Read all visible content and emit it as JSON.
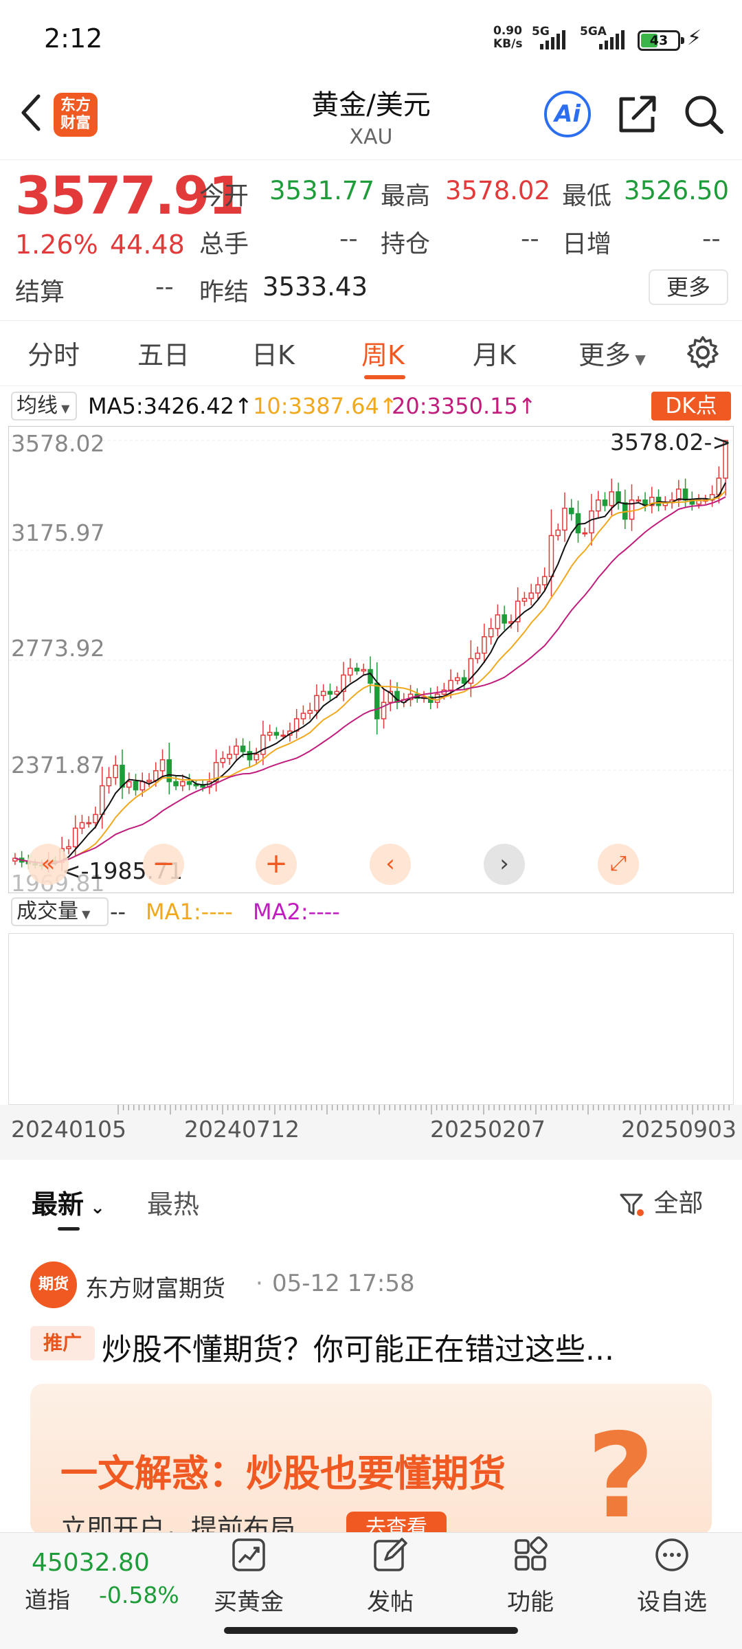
{
  "status": {
    "time": "2:12",
    "net_speed_value": "0.90",
    "net_speed_unit": "KB/s",
    "sig1": "5G",
    "sig2": "5GA",
    "battery": "43"
  },
  "header": {
    "back": "back",
    "logo_text": "东方\n财富",
    "title": "黄金/美元",
    "subtitle": "XAU",
    "ai_label": "Ai"
  },
  "quote": {
    "price": "3577.91",
    "change_pct": "1.26%",
    "change_abs": "44.48",
    "open_label": "今开",
    "open": "3531.77",
    "high_label": "最高",
    "high": "3578.02",
    "low_label": "最低",
    "low": "3526.50",
    "volume_label": "总手",
    "volume": "--",
    "position_label": "持仓",
    "position": "--",
    "daily_inc_label": "日增",
    "daily_inc": "--",
    "settle_label": "结算",
    "settle": "--",
    "prev_settle_label": "昨结",
    "prev_settle": "3533.43",
    "more_button": "更多"
  },
  "tabs": {
    "items": [
      "分时",
      "五日",
      "日K",
      "周K",
      "月K",
      "更多"
    ],
    "active": "周K"
  },
  "ma": {
    "selector": "均线",
    "ma5": "MA5:3426.42↑",
    "ma10": "10:3387.64↑",
    "ma20": "20:3350.15↑",
    "dk_button": "DK点"
  },
  "colors": {
    "up": "#e23a3a",
    "down": "#1e9c3a",
    "ma5": "#111111",
    "ma10": "#f0a81c",
    "ma20": "#c01c7c",
    "accent": "#f05a22"
  },
  "chart_data": {
    "type": "candlestick",
    "interval": "weekly",
    "y_ticks": [
      "3578.02",
      "3175.97",
      "2773.92",
      "2371.87",
      "1969.81"
    ],
    "ylim": [
      1969.81,
      3578.02
    ],
    "max_label": "3578.02->",
    "min_label": "<-1985.71",
    "x_ticks": [
      "20240105",
      "20240712",
      "20250207",
      "20250903"
    ],
    "close_series": [
      2050,
      2036,
      2030,
      2025,
      2022,
      2040,
      2035,
      2085,
      2092,
      2160,
      2180,
      2180,
      2210,
      2315,
      2345,
      2390,
      2310,
      2330,
      2300,
      2330,
      2335,
      2370,
      2410,
      2330,
      2315,
      2330,
      2320,
      2315,
      2310,
      2330,
      2400,
      2415,
      2430,
      2460,
      2440,
      2410,
      2430,
      2500,
      2510,
      2500,
      2500,
      2515,
      2560,
      2580,
      2590,
      2645,
      2660,
      2650,
      2660,
      2720,
      2745,
      2735,
      2740,
      2690,
      2560,
      2620,
      2660,
      2620,
      2630,
      2650,
      2635,
      2640,
      2620,
      2650,
      2665,
      2700,
      2710,
      2690,
      2780,
      2800,
      2860,
      2890,
      2940,
      2910,
      2915,
      2990,
      3000,
      3020,
      3050,
      3080,
      3230,
      3250,
      3330,
      3310,
      3240,
      3240,
      3320,
      3360,
      3340,
      3390,
      3350,
      3290,
      3360,
      3360,
      3340,
      3370,
      3340,
      3350,
      3360,
      3400,
      3360,
      3345,
      3360,
      3360,
      3380,
      3440,
      3577.91
    ],
    "ma5": "3426.42",
    "ma10": "3387.64",
    "ma20": "3350.15"
  },
  "volume": {
    "selector": "成交量",
    "value": "--",
    "ma1": "MA1:----",
    "ma2": "MA2:----"
  },
  "news": {
    "tabs": [
      "最新",
      "最热"
    ],
    "filter": "全部",
    "source": "东方财富期货",
    "date": "05-12 17:58",
    "avatar_text": "期货",
    "promo_tag": "推广",
    "headline": "炒股不懂期货？你可能正在错过这些...",
    "banner_title": "一文解惑：炒股也要懂期货",
    "banner_sub": "立即开户，提前布局",
    "banner_button": "去查看"
  },
  "bottom": {
    "index_value": "45032.80",
    "index_name": "道指",
    "index_change": "-0.58%",
    "nav": [
      "买黄金",
      "发帖",
      "功能",
      "设自选"
    ]
  }
}
